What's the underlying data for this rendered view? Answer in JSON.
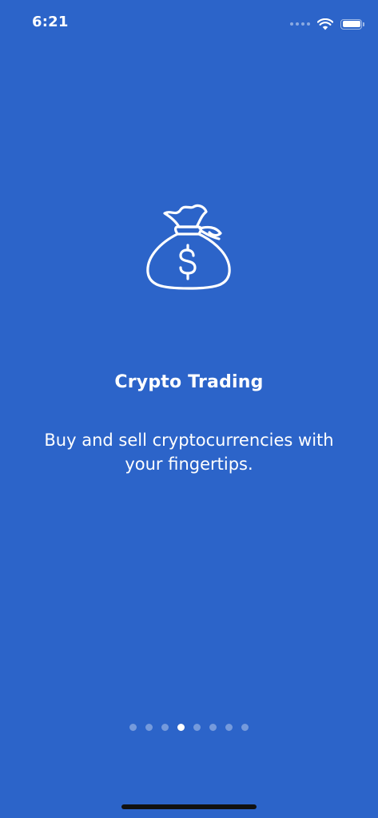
{
  "status_bar": {
    "time": "6:21"
  },
  "onboarding": {
    "icon": "money-bag-icon",
    "title": "Crypto Trading",
    "description_line1": "Buy and sell cryptocurrencies with",
    "description_line2": "your fingertips."
  },
  "pager": {
    "total_pages": 8,
    "current_page": 4
  },
  "colors": {
    "background": "#2c64c9",
    "text": "#ffffff",
    "home_indicator": "#111111"
  }
}
